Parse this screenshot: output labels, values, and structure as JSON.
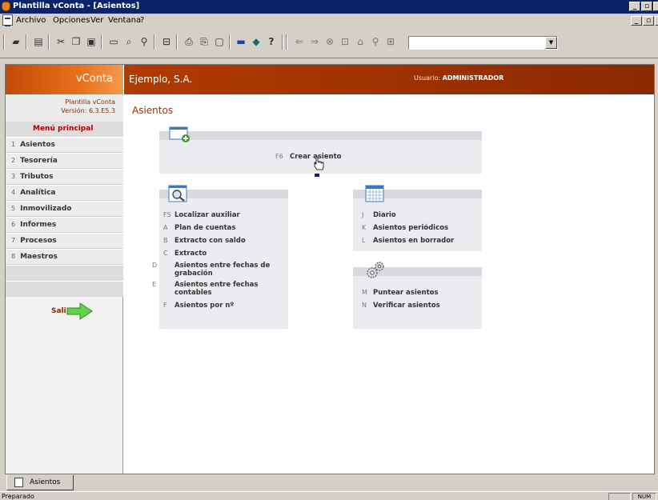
{
  "window": {
    "title": "Plantilla vConta - [Asientos]"
  },
  "menubar": {
    "items": [
      "Archivo",
      "Opciones",
      "Ver",
      "Ventana",
      "?"
    ]
  },
  "toolbar": {
    "combo_value": ""
  },
  "brand": {
    "name": "vConta",
    "template": "Plantilla vConta",
    "version": "Versión: 6.3.E5.3"
  },
  "header": {
    "company": "Ejemplo, S.A.",
    "user_label": "Usuario:",
    "user_name": "ADMINISTRADOR"
  },
  "sidebar": {
    "menu_title": "Menú principal",
    "items": [
      {
        "num": "1",
        "label": "Asientos"
      },
      {
        "num": "2",
        "label": "Tesorería"
      },
      {
        "num": "3",
        "label": "Tributos"
      },
      {
        "num": "4",
        "label": "Analítica"
      },
      {
        "num": "5",
        "label": "Inmovilizado"
      },
      {
        "num": "6",
        "label": "Informes"
      },
      {
        "num": "7",
        "label": "Procesos"
      },
      {
        "num": "8",
        "label": "Maestros"
      }
    ],
    "exit_label": "Salir"
  },
  "page": {
    "title": "Asientos"
  },
  "create": {
    "key": "F6",
    "label": "Crear asiento"
  },
  "search_panel": {
    "links": [
      {
        "key": "F5",
        "label": "Localizar auxiliar"
      },
      {
        "key": "A",
        "label": "Plan de cuentas"
      },
      {
        "key": "B",
        "label": "Extracto con saldo"
      },
      {
        "key": "C",
        "label": "Extracto"
      },
      {
        "key": "D",
        "label": "Asientos entre fechas de grabación"
      },
      {
        "key": "E",
        "label": "Asientos entre fechas contables"
      },
      {
        "key": "F",
        "label": "Asientos por nº"
      }
    ]
  },
  "calendar_panel": {
    "links": [
      {
        "key": "J",
        "label": "Diario"
      },
      {
        "key": "K",
        "label": "Asientos periódicos"
      },
      {
        "key": "L",
        "label": "Asientos en borrador"
      }
    ]
  },
  "gears_panel": {
    "links": [
      {
        "key": "M",
        "label": "Puntear asientos"
      },
      {
        "key": "N",
        "label": "Verificar asientos"
      }
    ]
  },
  "tabs": [
    {
      "label": "Asientos"
    }
  ],
  "status": {
    "text": "Preparado",
    "num": "NUM"
  },
  "colors": {
    "brand": "#e8731d",
    "header": "#a33600",
    "accent_text": "#a33200"
  }
}
